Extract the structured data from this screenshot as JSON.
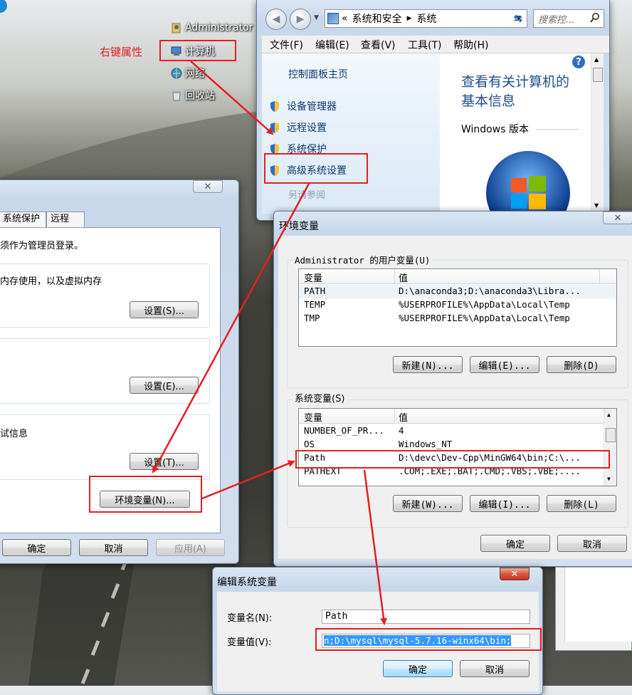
{
  "desktop": {
    "icons": [
      {
        "label": "Administrator"
      },
      {
        "label": "计算机"
      },
      {
        "label": "网络"
      },
      {
        "label": "回收站"
      }
    ],
    "annotation": "右键属性"
  },
  "system_window": {
    "breadcrumb": {
      "prefix": "«",
      "parent": "系统和安全",
      "current": "系统"
    },
    "search_placeholder": "搜索控...",
    "menu": [
      "文件(F)",
      "编辑(E)",
      "查看(V)",
      "工具(T)",
      "帮助(H)"
    ],
    "sidebar": {
      "home": "控制面板主页",
      "items": [
        "设备管理器",
        "远程设置",
        "系统保护",
        "高级系统设置"
      ],
      "partial": "另请参阅"
    },
    "main": {
      "heading_line1": "查看有关计算机的",
      "heading_line2": "基本信息",
      "section": "Windows 版本"
    }
  },
  "properties_dialog": {
    "tabs": [
      "系统保护",
      "远程"
    ],
    "admin_note": "须作为管理员登录。",
    "perf_text": "内存使用，以及虚拟内存",
    "perf_settings": "设置(S)...",
    "profile_settings": "设置(E)...",
    "startup_text": "试信息",
    "startup_settings": "设置(T)...",
    "env_button": "环境变量(N)...",
    "ok": "确定",
    "cancel": "取消",
    "apply": "应用(A)"
  },
  "env_dialog": {
    "title": "环境变量",
    "user_group": "Administrator 的用户变量(U)",
    "col_var": "变量",
    "col_val": "值",
    "user_vars": [
      {
        "name": "PATH",
        "value": "D:\\anaconda3;D:\\anaconda3\\Libra..."
      },
      {
        "name": "TEMP",
        "value": "%USERPROFILE%\\AppData\\Local\\Temp"
      },
      {
        "name": "TMP",
        "value": "%USERPROFILE%\\AppData\\Local\\Temp"
      }
    ],
    "user_buttons": [
      "新建(N)...",
      "编辑(E)...",
      "删除(D)"
    ],
    "sys_group": "系统变量(S)",
    "sys_vars": [
      {
        "name": "NUMBER_OF_PR...",
        "value": "4"
      },
      {
        "name": "OS",
        "value": "Windows_NT"
      },
      {
        "name": "Path",
        "value": "D:\\devc\\Dev-Cpp\\MinGW64\\bin;C:\\..."
      },
      {
        "name": "PATHEXT",
        "value": ".COM;.EXE;.BAT;.CMD;.VBS;.VBE;...."
      }
    ],
    "sys_buttons": [
      "新建(W)...",
      "编辑(I)...",
      "删除(L)"
    ],
    "ok": "确定",
    "cancel": "取消"
  },
  "edit_dialog": {
    "title": "编辑系统变量",
    "name_label": "变量名(N):",
    "name_value": "Path",
    "value_label": "变量值(V):",
    "value_value": "n;D:\\mysql\\mysql-5.7.16-winx64\\bin;",
    "ok": "确定",
    "cancel": "取消"
  },
  "colors": {
    "annotation_red": "#e41f1f",
    "link_blue": "#0b3a70",
    "selection_blue": "#3399ff"
  }
}
